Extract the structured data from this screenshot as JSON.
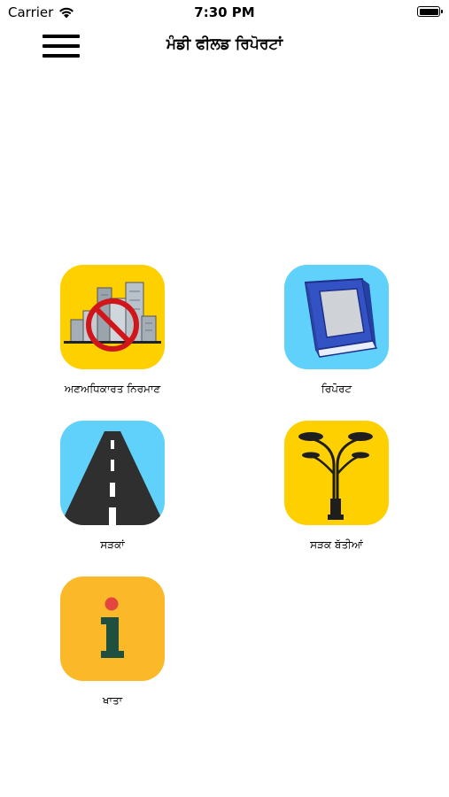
{
  "status": {
    "carrier": "Carrier",
    "time": "7:30 PM"
  },
  "header": {
    "title": "ਮੰਡੀ ਫੀਲਡ ਰਿਪੋਰਟਾਂ"
  },
  "tiles": [
    {
      "label": "ਅਣਅਧਿਕਾਰਤ ਨਿਰਮਾਣ",
      "icon": "no-building-icon",
      "bg": "#FFD000"
    },
    {
      "label": "ਰਿਪੋਰਟ",
      "icon": "report-book-icon",
      "bg": "#5FD1FA"
    },
    {
      "label": "ਸੜਕਾਂ",
      "icon": "road-icon",
      "bg": "#5FD1FA"
    },
    {
      "label": "ਸੜਕ ਬੱਤੀਆਂ",
      "icon": "street-light-icon",
      "bg": "#FFD000"
    },
    {
      "label": "ਖਾਤਾ",
      "icon": "info-account-icon",
      "bg": "#FBB829"
    }
  ]
}
